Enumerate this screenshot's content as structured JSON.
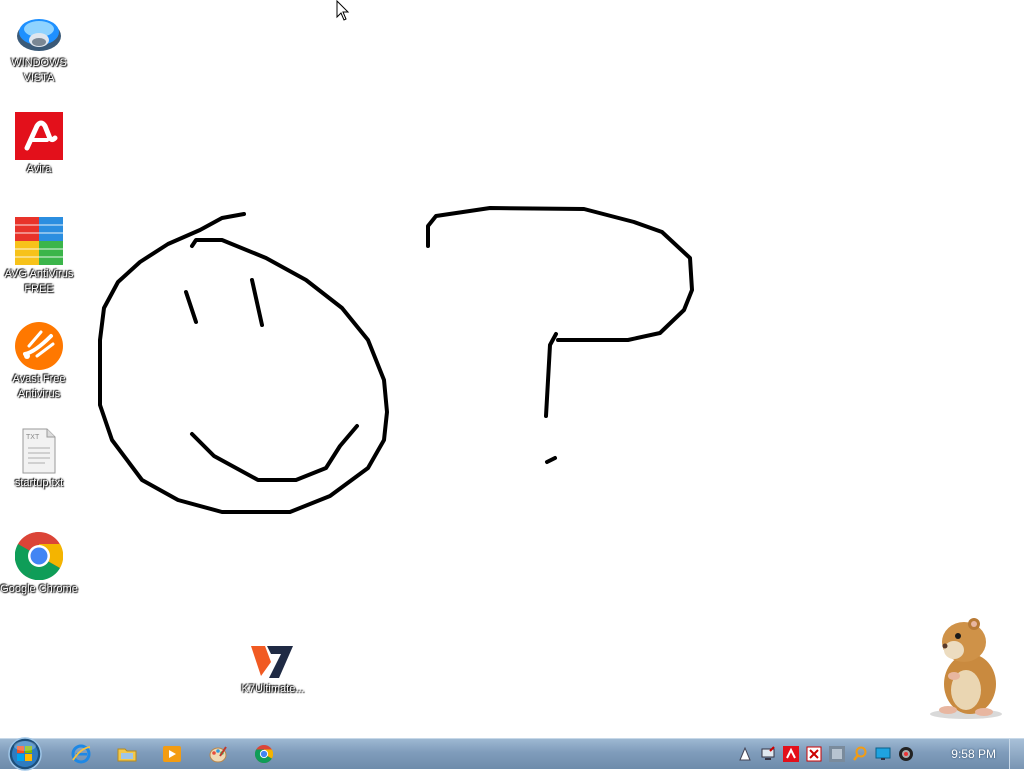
{
  "desktop": {
    "icons": [
      {
        "label": "WINDOWS VISTA",
        "icon": "windows-vista-icon"
      },
      {
        "label": "Avira",
        "icon": "avira-icon"
      },
      {
        "label": "AVG AntiVirus FREE",
        "icon": "avg-icon"
      },
      {
        "label": "Avast Free Antivirus",
        "icon": "avast-icon"
      },
      {
        "label": "startup.txt",
        "icon": "text-file-icon"
      },
      {
        "label": "Google Chrome",
        "icon": "chrome-icon"
      },
      {
        "label": "K7Ultimate...",
        "icon": "k7-icon"
      }
    ],
    "k7_logo_text": "7",
    "text_file_badge": "TXT"
  },
  "taskbar": {
    "clock": "9:58 PM",
    "pinned": [
      "internet-explorer-icon",
      "file-explorer-icon",
      "media-player-icon",
      "paint-icon",
      "chrome-icon"
    ],
    "tray": [
      "action-center-flag-icon",
      "network-icon",
      "avira-tray-icon",
      "avast-tray-icon",
      "avg-tray-icon",
      "search-tray-icon",
      "display-icon",
      "volume-icon"
    ]
  },
  "colors": {
    "avira_red": "#e3101b",
    "avast_orange": "#ff7800",
    "k7_orange": "#f15a22",
    "k7_dark": "#1f2a44"
  }
}
